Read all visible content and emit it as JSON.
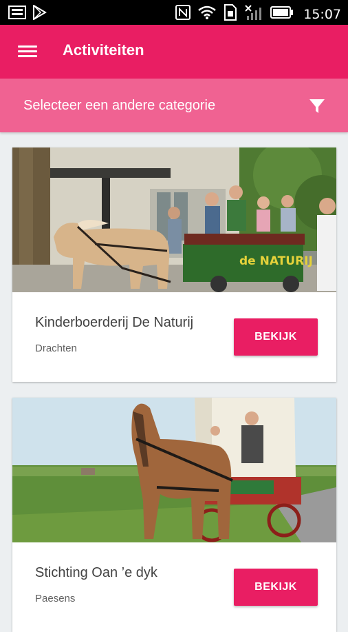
{
  "status_bar": {
    "time": "15:07",
    "icons": [
      "image-icon",
      "play-store-icon",
      "nfc-icon",
      "wifi-icon",
      "sim-icon",
      "no-signal-icon",
      "battery-icon"
    ]
  },
  "app_bar": {
    "title": "Activiteiten",
    "menu_icon": "menu-icon"
  },
  "category_bar": {
    "label": "Selecteer een andere categorie",
    "icon": "filter-icon"
  },
  "colors": {
    "primary": "#e91e63",
    "category_bar": "#f06292",
    "background": "#eceff1"
  },
  "activities": [
    {
      "title": "Kinderboerderij De Naturij",
      "location": "Drachten",
      "button": "BEKIJK",
      "sign_text": "de NATURIJ"
    },
    {
      "title": "Stichting Oan ’e dyk",
      "location": "Paesens",
      "button": "BEKIJK"
    }
  ]
}
